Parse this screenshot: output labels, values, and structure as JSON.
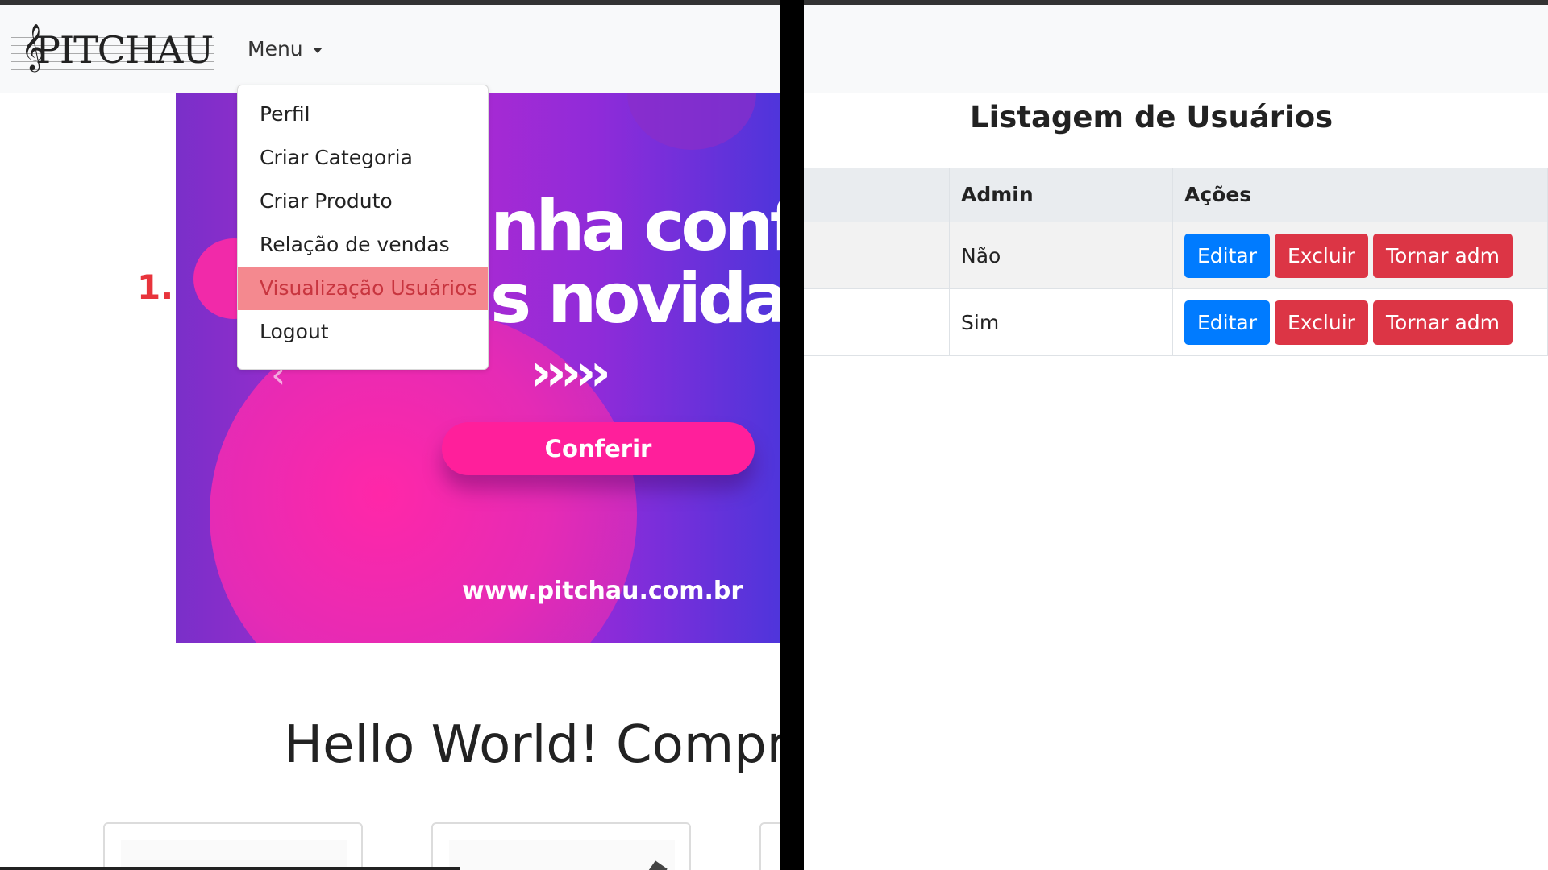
{
  "left": {
    "logo_text": "PITCHAU",
    "menu_label": "Menu",
    "dropdown_items": [
      "Perfil",
      "Criar Categoria",
      "Criar Produto",
      "Relação de vendas",
      "Visualização Usuários",
      "Logout"
    ],
    "active_item_index": 4,
    "step_label": "1.",
    "banner": {
      "headline_line1": "nha confer",
      "headline_line2": "s novidad",
      "arrows": "›››››",
      "cta_label": "Conferir",
      "url": "www.pitchau.com.br"
    },
    "hello_text": "Hello World! Compr"
  },
  "right": {
    "title": "Listagem de Usuários",
    "table": {
      "headers": [
        "",
        "Admin",
        "Ações"
      ],
      "rows": [
        {
          "admin": "Não",
          "actions": [
            "Editar",
            "Excluir",
            "Tornar adm"
          ]
        },
        {
          "admin": "Sim",
          "actions": [
            "Editar",
            "Excluir",
            "Tornar adm"
          ]
        }
      ]
    }
  },
  "colors": {
    "primary": "#007bff",
    "danger": "#dc3545",
    "highlight": "#f4898f",
    "step_label": "#e8343c",
    "banner_pink": "#ff1f9b",
    "banner_purple": "#7a2fc9"
  }
}
